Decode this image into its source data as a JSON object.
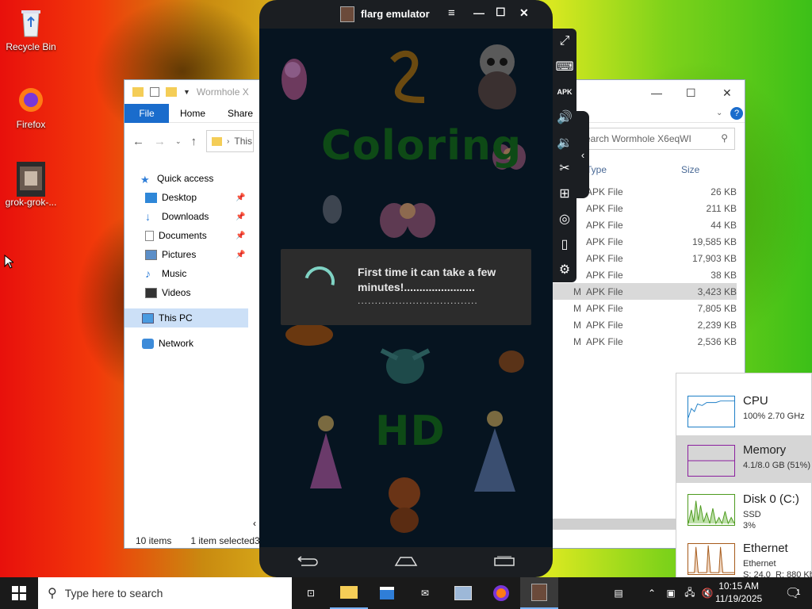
{
  "desktop": {
    "icons": [
      {
        "label": "Recycle Bin"
      },
      {
        "label": "Firefox"
      },
      {
        "label": "grok-grok-..."
      }
    ]
  },
  "explorer": {
    "title": "Wormhole X",
    "ribbon": {
      "file": "File",
      "home": "Home",
      "share": "Share"
    },
    "address": "This",
    "search_placeholder": "earch Wormhole X6eqWI",
    "columns": {
      "type": "Type",
      "size": "Size"
    },
    "nav": [
      {
        "label": "Quick access"
      },
      {
        "label": "Desktop",
        "pinned": true
      },
      {
        "label": "Downloads",
        "pinned": true
      },
      {
        "label": "Documents",
        "pinned": true
      },
      {
        "label": "Pictures",
        "pinned": true
      },
      {
        "label": "Music"
      },
      {
        "label": "Videos"
      },
      {
        "label": "This PC",
        "selected": true
      },
      {
        "label": "Network"
      }
    ],
    "files": [
      {
        "type": "APK File",
        "size": "26 KB"
      },
      {
        "type": "APK File",
        "size": "211 KB"
      },
      {
        "type": "APK File",
        "size": "44 KB"
      },
      {
        "type": "APK File",
        "size": "19,585 KB"
      },
      {
        "type": "APK File",
        "size": "17,903 KB"
      },
      {
        "type": "APK File",
        "size": "38 KB"
      },
      {
        "type": "APK File",
        "size": "3,423 KB",
        "selected": true,
        "m": "M"
      },
      {
        "type": "APK File",
        "size": "7,805 KB",
        "m": "M"
      },
      {
        "type": "APK File",
        "size": "2,239 KB",
        "m": "M"
      },
      {
        "type": "APK File",
        "size": "2,536 KB",
        "m": "M"
      }
    ],
    "status": {
      "items": "10 items",
      "selected": "1 item selected",
      "extra": "3"
    }
  },
  "emulator": {
    "title": "flarg emulator",
    "app_title_top": "Coloring",
    "app_title_bottom": "HD",
    "dialog": {
      "message": "First time it can take a few minutes!.......................",
      "dots": "..................................."
    }
  },
  "perf": {
    "items": [
      {
        "name": "CPU",
        "sub": "100% 2.70 GHz",
        "color": "#1e7fc7"
      },
      {
        "name": "Memory",
        "sub": "4.1/8.0 GB (51%)",
        "color": "#8b1f9e"
      },
      {
        "name": "Disk 0 (C:)",
        "sub": "SSD\n3%",
        "color": "#4d9a1e"
      },
      {
        "name": "Ethernet",
        "sub": "Ethernet\nS: 24.0  R: 880 Kb",
        "color": "#a65a1a"
      }
    ]
  },
  "taskbar": {
    "search_placeholder": "Type here to search",
    "time": "10:15 AM",
    "date": "11/19/2025",
    "notification_count": "1"
  }
}
